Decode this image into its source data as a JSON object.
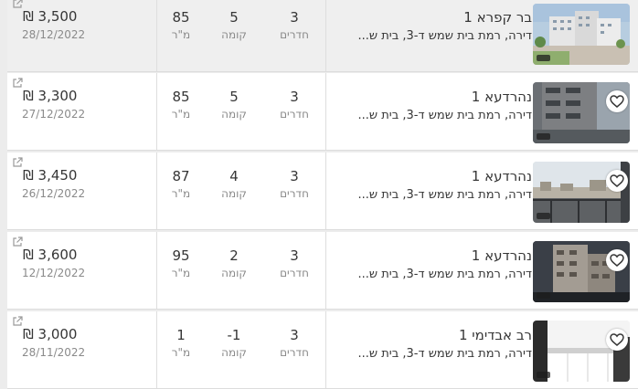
{
  "listings": [
    {
      "title": "בר קפרא 1",
      "subtitle": "דירה, רמת בית שמש ד-3, בית ש...",
      "rooms": "3",
      "rooms_label": "חדרים",
      "floor": "5",
      "floor_label": "קומה",
      "size": "85",
      "size_label": "מ\"ר",
      "price": "₪ 3,500",
      "date": "28/12/2022"
    },
    {
      "title": "נהרדעא 1",
      "subtitle": "דירה, רמת בית שמש ד-3, בית ש...",
      "rooms": "3",
      "rooms_label": "חדרים",
      "floor": "5",
      "floor_label": "קומה",
      "size": "85",
      "size_label": "מ\"ר",
      "price": "₪ 3,300",
      "date": "27/12/2022"
    },
    {
      "title": "נהרדעא 1",
      "subtitle": "דירה, רמת בית שמש ד-3, בית ש...",
      "rooms": "3",
      "rooms_label": "חדרים",
      "floor": "4",
      "floor_label": "קומה",
      "size": "87",
      "size_label": "מ\"ר",
      "price": "₪ 3,450",
      "date": "26/12/2022"
    },
    {
      "title": "נהרדעא 1",
      "subtitle": "דירה, רמת בית שמש ד-3, בית ש...",
      "rooms": "3",
      "rooms_label": "חדרים",
      "floor": "2",
      "floor_label": "קומה",
      "size": "95",
      "size_label": "מ\"ר",
      "price": "₪ 3,600",
      "date": "12/12/2022"
    },
    {
      "title": "רב אבדימי 1",
      "subtitle": "דירה, רמת בית שמש ד-3, בית ש...",
      "rooms": "3",
      "rooms_label": "חדרים",
      "floor": "-1",
      "floor_label": "קומה",
      "size": "1",
      "size_label": "מ\"ר",
      "price": "₪ 3,000",
      "date": "28/11/2022"
    }
  ],
  "icons": {
    "external_link": "external-link-icon",
    "favorite": "heart-icon",
    "image_badge": "image-count-badge"
  },
  "colors": {
    "row_bg": "#ffffff",
    "row_highlight_bg": "#efefef",
    "page_bg": "#ececec",
    "text": "#363636",
    "muted": "#8a8a8a"
  }
}
